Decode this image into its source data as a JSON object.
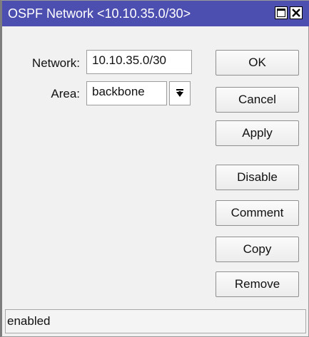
{
  "window": {
    "title": "OSPF Network <10.10.35.0/30>",
    "title_bar_color": "#4d4fb0",
    "maximize_icon": "maximize-icon",
    "close_icon": "close-icon"
  },
  "form": {
    "network_label": "Network:",
    "network_value": "10.10.35.0/30",
    "area_label": "Area:",
    "area_value": "backbone",
    "area_dropdown_icon": "dropdown-arrow-icon"
  },
  "buttons": {
    "ok": "OK",
    "cancel": "Cancel",
    "apply": "Apply",
    "disable": "Disable",
    "comment": "Comment",
    "copy": "Copy",
    "remove": "Remove"
  },
  "status": {
    "text": "enabled"
  }
}
